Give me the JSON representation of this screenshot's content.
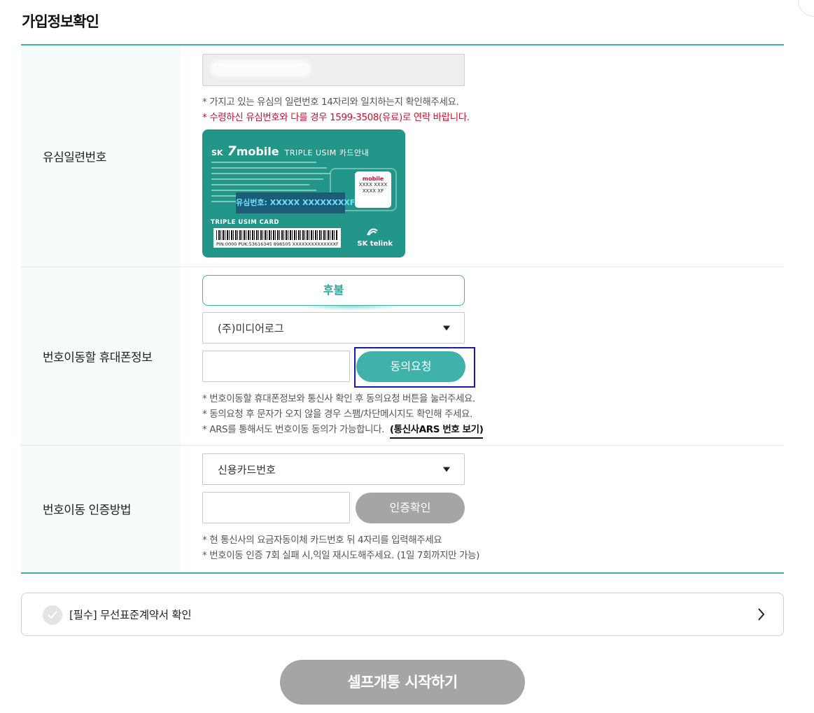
{
  "title": "가입정보확인",
  "usim": {
    "label": "유심일련번호",
    "note1": "* 가지고 있는 유심의 일련번호 14자리와 일치하는지 확인해주세요.",
    "note2": "* 수령하신 유심번호와 다를 경우 1599-3508(유료)로 연락 바랍니다.",
    "card": {
      "brand_sk": "SK",
      "brand_seven": "7",
      "brand_mobile": "mobile",
      "brand_subtitle": "TRIPLE USIM 카드안내",
      "serial": "유심번호: XXXXX XXXXXXXXF",
      "card_label": "TRIPLE USIM CARD",
      "sim_brand": "mobile",
      "sim_number": "XXXX XXXX XXXX XF",
      "barcode_text": "PIN:0000  PUK:53616345 898505 XXXXXXXXXXXXXXF",
      "footer_logo": "SK telink"
    }
  },
  "phone": {
    "label": "번호이동할 휴대폰정보",
    "plan_toggle": "후불",
    "carrier_selected": "(주)미디어로그",
    "consent_button": "동의요청",
    "note1": "* 번호이동할 휴대폰정보와 통신사 확인 후 동의요청 버튼을 눌러주세요.",
    "note2": "* 동의요청 후 문자가 오지 않을 경우 스팸/차단메시지도 확인해 주세요.",
    "note3": "* ARS를 통해서도 번호이동 동의가 가능합니다.",
    "ars_link": "(통신사ARS 번호 보기)"
  },
  "auth": {
    "label": "번호이동 인증방법",
    "method_selected": "신용카드번호",
    "confirm_button": "인증확인",
    "note1": "* 현 통신사의 요금자동이체 카드번호 뒤 4자리를 입력해주세요",
    "note2": "* 번호이동 인증 7회 실패 시,익일 재시도해주세요. (1일 7회까지만 가능)"
  },
  "agreement": {
    "label": "[필수] 무선표준계약서 확인"
  },
  "start_button": "셀프개통 시작하기",
  "colors": {
    "accent": "#3fb3a9",
    "disabled": "#a5a5a5",
    "warning": "#c8102e"
  }
}
